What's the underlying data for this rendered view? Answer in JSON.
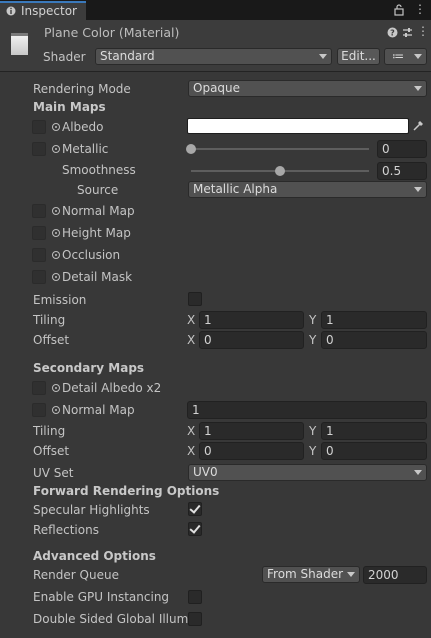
{
  "tab": {
    "label": "Inspector",
    "icon": "info-icon"
  },
  "header": {
    "title": "Plane Color (Material)",
    "shader_label": "Shader",
    "shader_value": "Standard",
    "edit_button": "Edit...",
    "menu_button": "≔"
  },
  "rendering_mode": {
    "label": "Rendering Mode",
    "value": "Opaque"
  },
  "main_maps": {
    "heading": "Main Maps",
    "albedo": {
      "label": "Albedo",
      "color": "#ffffff"
    },
    "metallic": {
      "label": "Metallic",
      "value": "0",
      "fraction": 0.0
    },
    "smoothness": {
      "label": "Smoothness",
      "value": "0.5",
      "fraction": 0.5
    },
    "source": {
      "label": "Source",
      "value": "Metallic Alpha"
    },
    "normal_map": "Normal Map",
    "height_map": "Height Map",
    "occlusion": "Occlusion",
    "detail_mask": "Detail Mask"
  },
  "emission": {
    "label": "Emission",
    "checked": false
  },
  "tiling": {
    "label": "Tiling",
    "x": "1",
    "y": "1"
  },
  "offset": {
    "label": "Offset",
    "x": "0",
    "y": "0"
  },
  "axes": {
    "x": "X",
    "y": "Y"
  },
  "secondary_maps": {
    "heading": "Secondary Maps",
    "detail_albedo": "Detail Albedo x2",
    "normal_map": {
      "label": "Normal Map",
      "value": "1"
    },
    "tiling": {
      "label": "Tiling",
      "x": "1",
      "y": "1"
    },
    "offset": {
      "label": "Offset",
      "x": "0",
      "y": "0"
    },
    "uv_set": {
      "label": "UV Set",
      "value": "UV0"
    }
  },
  "forward_rendering": {
    "heading": "Forward Rendering Options",
    "specular_highlights": {
      "label": "Specular Highlights",
      "checked": true
    },
    "reflections": {
      "label": "Reflections",
      "checked": true
    }
  },
  "advanced": {
    "heading": "Advanced Options",
    "render_queue": {
      "label": "Render Queue",
      "mode": "From Shader",
      "value": "2000"
    },
    "gpu_instancing": {
      "label": "Enable GPU Instancing",
      "checked": false
    },
    "double_sided_gi": {
      "label": "Double Sided Global Illumin",
      "checked": false
    }
  },
  "colors": {
    "background": "#383838",
    "accent": "#3a79bb"
  }
}
